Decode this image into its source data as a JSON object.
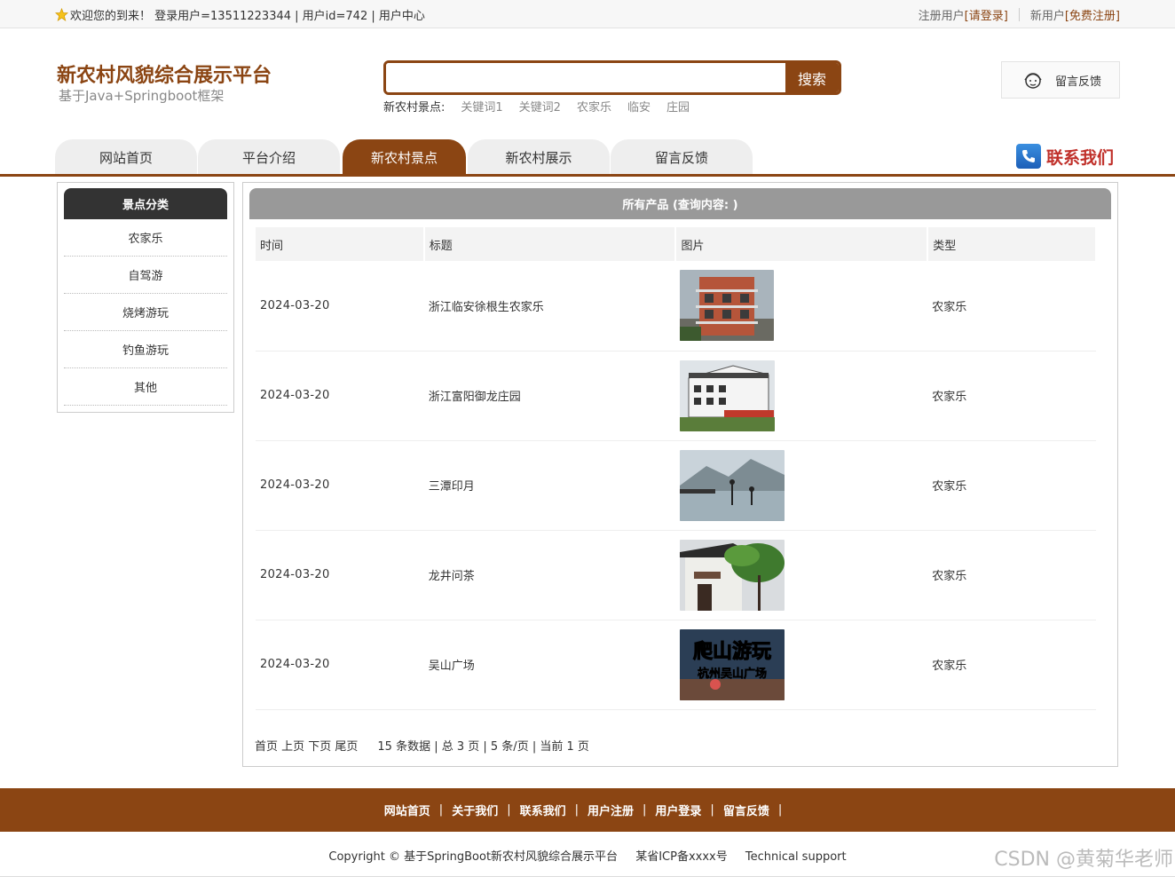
{
  "topbar": {
    "welcome": "欢迎您的到来！ 登录用户=13511223344 | 用户id=742 | 用户中心",
    "registered_label": "注册用户",
    "login_link": "[请登录]",
    "new_user_label": "新用户",
    "signup_link": "[免费注册]"
  },
  "header": {
    "title": "新农村风貌综合展示平台",
    "subtitle": "基于Java+Springboot框架",
    "search_placeholder": "",
    "search_button": "搜索",
    "hotwords_label": "新农村景点:",
    "hotwords": [
      "关键词1",
      "关键词2",
      "农家乐",
      "临安",
      "庄园"
    ],
    "feedback_button": "留言反馈"
  },
  "nav": {
    "items": [
      "网站首页",
      "平台介绍",
      "新农村景点",
      "新农村展示",
      "留言反馈"
    ],
    "active_index": 2,
    "contact": "联系我们"
  },
  "sidebar": {
    "title": "景点分类",
    "items": [
      "农家乐",
      "自驾游",
      "烧烤游玩",
      "钓鱼游玩",
      "其他"
    ]
  },
  "main": {
    "title": "所有产品 (查询内容: )",
    "columns": [
      "时间",
      "标题",
      "图片",
      "类型"
    ],
    "rows": [
      {
        "date": "2024-03-20",
        "title": "浙江临安徐根生农家乐",
        "image": "building-photo",
        "type": "农家乐"
      },
      {
        "date": "2024-03-20",
        "title": "浙江富阳御龙庄园",
        "image": "manor-photo",
        "type": "农家乐"
      },
      {
        "date": "2024-03-20",
        "title": "三潭印月",
        "image": "lake-photo",
        "type": "农家乐"
      },
      {
        "date": "2024-03-20",
        "title": "龙井问茶",
        "image": "garden-photo",
        "type": "农家乐"
      },
      {
        "date": "2024-03-20",
        "title": "吴山广场",
        "image": "poster-photo",
        "type": "农家乐",
        "image_text_1": "爬山游玩",
        "image_text_2": "杭州吴山广场"
      }
    ],
    "pager": {
      "links": "首页 上页 下页 尾页",
      "info": "15 条数据 | 总 3 页 | 5 条/页 | 当前 1 页"
    }
  },
  "footer": {
    "links": [
      "网站首页",
      "关于我们",
      "联系我们",
      "用户注册",
      "用户登录",
      "留言反馈"
    ],
    "copyright": "Copyright © 基于SpringBoot新农村风貌综合展示平台",
    "icp": "某省ICP备xxxx号",
    "support": "Technical support",
    "watermark": "CSDN @黄菊华老师"
  },
  "colors": {
    "brand": "#8b4513",
    "panel_head": "#999999",
    "sidebar_head": "#333333"
  }
}
